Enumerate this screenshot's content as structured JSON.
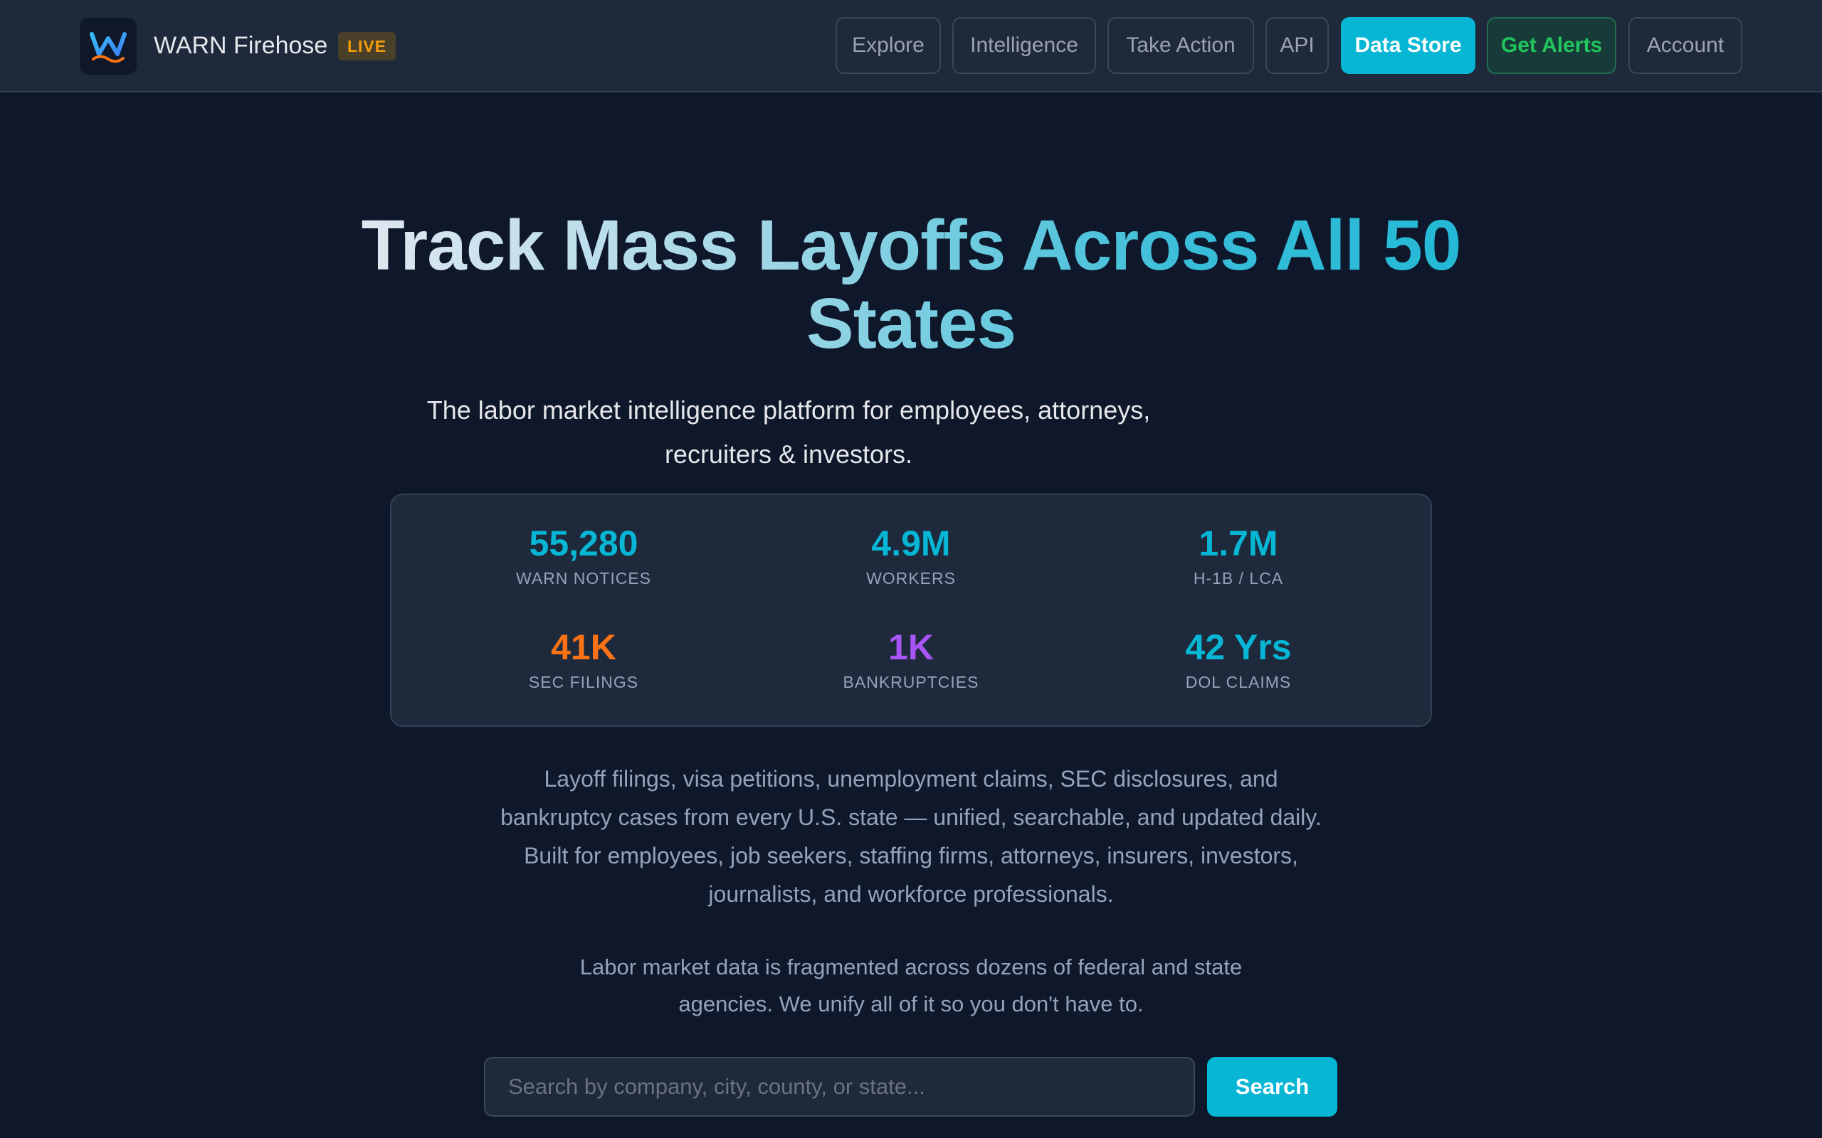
{
  "header": {
    "logo_icon": "warn-firehose-logo-icon",
    "brand_name": "WARN Firehose",
    "live_badge": "LIVE",
    "nav": {
      "explore": "Explore",
      "intelligence": "Intelligence",
      "take_action": "Take Action",
      "api": "API",
      "data_store": "Data Store",
      "get_alerts": "Get Alerts",
      "account": "Account"
    }
  },
  "hero": {
    "title": "Track Mass Layoffs Across All 50 States",
    "subtitle": "The labor market intelligence platform for employees, attorneys, recruiters & investors."
  },
  "stats": [
    {
      "value": "55,280",
      "label": "WARN NOTICES",
      "color": "#06b6d4"
    },
    {
      "value": "4.9M",
      "label": "WORKERS",
      "color": "#06b6d4"
    },
    {
      "value": "1.7M",
      "label": "H-1B / LCA",
      "color": "#06b6d4"
    },
    {
      "value": "41K",
      "label": "SEC FILINGS",
      "color": "#f97316"
    },
    {
      "value": "1K",
      "label": "BANKRUPTCIES",
      "color": "#a855f7"
    },
    {
      "value": "42 Yrs",
      "label": "DOL CLAIMS",
      "color": "#06b6d4"
    }
  ],
  "description": {
    "main": "Layoff filings, visa petitions, unemployment claims, SEC disclosures, and bankruptcy cases from every U.S. state — unified, searchable, and updated daily. Built for employees, job seekers, staffing firms, attorneys, insurers, investors, journalists, and workforce professionals.",
    "secondary": "Labor market data is fragmented across dozens of federal and state agencies. We unify all of it so you don't have to."
  },
  "search": {
    "placeholder": "Search by company, city, county, or state...",
    "value": "",
    "button_label": "Search"
  },
  "colors": {
    "background": "#0f172a",
    "surface": "#1e293b",
    "accent": "#06b6d4",
    "alerts_green": "#22c55e",
    "live_amber": "#f59e0b"
  }
}
